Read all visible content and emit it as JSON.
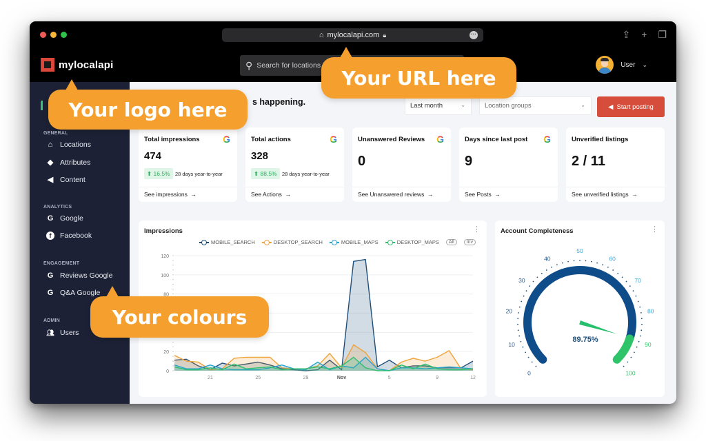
{
  "browser": {
    "url": "mylocalapi.com",
    "toolbar_icons": [
      "share-icon",
      "new-tab-icon",
      "tabs-overview-icon"
    ]
  },
  "header": {
    "logo_text": "mylocalapi",
    "search_placeholder": "Search for locations",
    "user_name": "User"
  },
  "sidebar": {
    "sections": [
      {
        "title": "GENERAL",
        "items": [
          {
            "label": "Locations",
            "icon": "home-icon"
          },
          {
            "label": "Attributes",
            "icon": "tag-icon"
          },
          {
            "label": "Content",
            "icon": "megaphone-icon"
          }
        ]
      },
      {
        "title": "ANALYTICS",
        "items": [
          {
            "label": "Google",
            "icon": "google-icon"
          },
          {
            "label": "Facebook",
            "icon": "facebook-icon"
          }
        ]
      },
      {
        "title": "ENGAGEMENT",
        "items": [
          {
            "label": "Reviews Google",
            "icon": "google-icon"
          },
          {
            "label": "Q&A Google",
            "icon": "google-icon"
          }
        ]
      },
      {
        "title": "ADMIN",
        "items": [
          {
            "label": "Users",
            "icon": "users-icon"
          }
        ]
      }
    ]
  },
  "main": {
    "greeting_fragment": "s happening.",
    "period_select": "Last month",
    "groups_select": "Location groups",
    "start_posting": "Start posting",
    "cards": [
      {
        "title": "Total impressions",
        "value": "474",
        "delta": "16.5%",
        "period": "28 days year-to-year",
        "link": "See impressions",
        "google": true
      },
      {
        "title": "Total actions",
        "value": "328",
        "delta": "88.5%",
        "period": "28 days year-to-year",
        "link": "See Actions",
        "google": true
      },
      {
        "title": "Unanswered Reviews",
        "value": "0",
        "link": "See Unanswered reviews",
        "google": true
      },
      {
        "title": "Days since last post",
        "value": "9",
        "link": "See Posts",
        "google": true
      },
      {
        "title": "Unverified listings",
        "value": "2 / 11",
        "link": "See unverified listings",
        "google": false
      }
    ],
    "arrow": "→",
    "impressions_title": "Impressions",
    "legend_all": "All",
    "legend_inv": "Inv",
    "gauge_title": "Account Completeness"
  },
  "chart_data": [
    {
      "type": "area",
      "title": "Impressions",
      "xlabel": "",
      "ylabel": "",
      "ylim": [
        0,
        120
      ],
      "yticks": [
        0,
        20,
        40,
        60,
        80,
        100,
        120
      ],
      "x_tick_labels": [
        "21",
        "25",
        "29",
        "Nov",
        "5",
        "9",
        "12"
      ],
      "x": [
        "Oct 18",
        "Oct 19",
        "Oct 20",
        "Oct 21",
        "Oct 22",
        "Oct 23",
        "Oct 24",
        "Oct 25",
        "Oct 26",
        "Oct 27",
        "Oct 28",
        "Oct 29",
        "Oct 30",
        "Oct 31",
        "Nov 1",
        "Nov 2",
        "Nov 3",
        "Nov 4",
        "Nov 5",
        "Nov 6",
        "Nov 7",
        "Nov 8",
        "Nov 9",
        "Nov 10",
        "Nov 11",
        "Nov 12"
      ],
      "legend_position": "top",
      "grid": true,
      "series": [
        {
          "name": "MOBILE_SEARCH",
          "color": "#1f4e79",
          "values": [
            11,
            12,
            5,
            1,
            8,
            5,
            7,
            9,
            6,
            2,
            1,
            0,
            1,
            11,
            1,
            114,
            116,
            4,
            11,
            3,
            5,
            5,
            3,
            3,
            3,
            10
          ]
        },
        {
          "name": "DESKTOP_SEARCH",
          "color": "#f0a23b",
          "values": [
            16,
            10,
            9,
            1,
            2,
            13,
            14,
            14,
            14,
            3,
            2,
            2,
            5,
            18,
            3,
            27,
            19,
            2,
            0,
            9,
            13,
            10,
            14,
            21,
            2,
            1
          ]
        },
        {
          "name": "MOBILE_MAPS",
          "color": "#29a3cf",
          "values": [
            6,
            2,
            2,
            6,
            2,
            1,
            1,
            1,
            3,
            6,
            2,
            1,
            9,
            1,
            5,
            3,
            14,
            2,
            0,
            3,
            3,
            2,
            3,
            4,
            3,
            2
          ]
        },
        {
          "name": "DESKTOP_MAPS",
          "color": "#2fbf71",
          "values": [
            4,
            1,
            1,
            3,
            1,
            7,
            2,
            3,
            4,
            1,
            2,
            2,
            4,
            2,
            5,
            14,
            3,
            0,
            0,
            6,
            2,
            7,
            2,
            1,
            1,
            2
          ]
        }
      ]
    },
    {
      "type": "gauge",
      "title": "Account Completeness",
      "value": 89.75,
      "value_label": "89.75%",
      "range": [
        0,
        100
      ],
      "tick_labels": [
        "0",
        "10",
        "20",
        "30",
        "40",
        "50",
        "60",
        "70",
        "80",
        "90",
        "100"
      ],
      "bands": [
        {
          "from": 0,
          "to": 90,
          "color": "#0f4d8a"
        },
        {
          "from": 90,
          "to": 100,
          "color": "#2fc46a"
        }
      ]
    }
  ],
  "callouts": {
    "logo": "Your logo here",
    "url": "Your URL here",
    "colours": "Your colours"
  }
}
